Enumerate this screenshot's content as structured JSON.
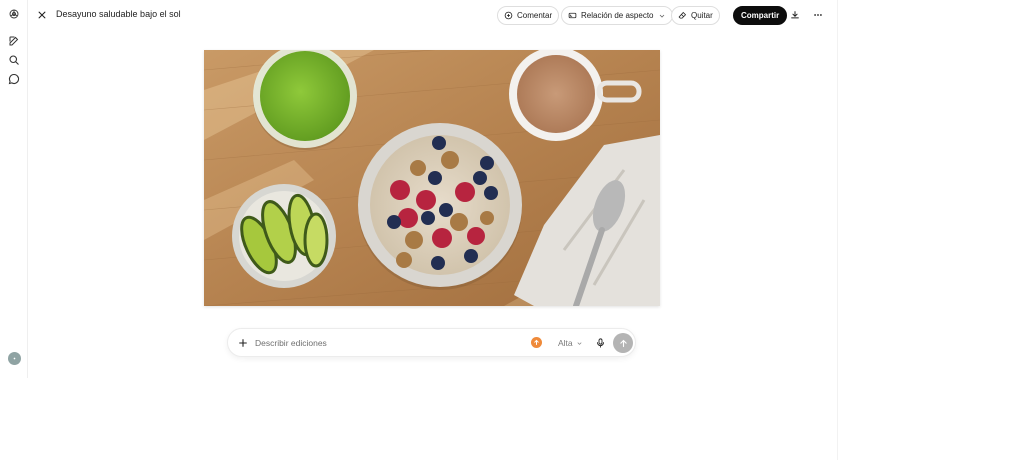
{
  "header": {
    "title": "Desayuno saludable bajo el sol",
    "comment_label": "Comentar",
    "aspect_label": "Relación de aspecto",
    "remove_label": "Quitar",
    "share_label": "Compartir"
  },
  "composer": {
    "placeholder": "Describir ediciones",
    "quality_label": "Alta"
  },
  "icons": {
    "logo": "openai-logo-icon",
    "new_chat": "edit-icon",
    "search": "search-icon",
    "chat": "chat-bubble-icon",
    "close": "close-icon",
    "download": "download-icon",
    "more": "more-icon",
    "add": "plus-icon",
    "mic": "microphone-icon",
    "send": "arrow-up-icon"
  },
  "colors": {
    "share_bg": "#0d0d0d",
    "upgrade_dot": "#ef8a3a",
    "send_bg": "#b4b4b4"
  }
}
